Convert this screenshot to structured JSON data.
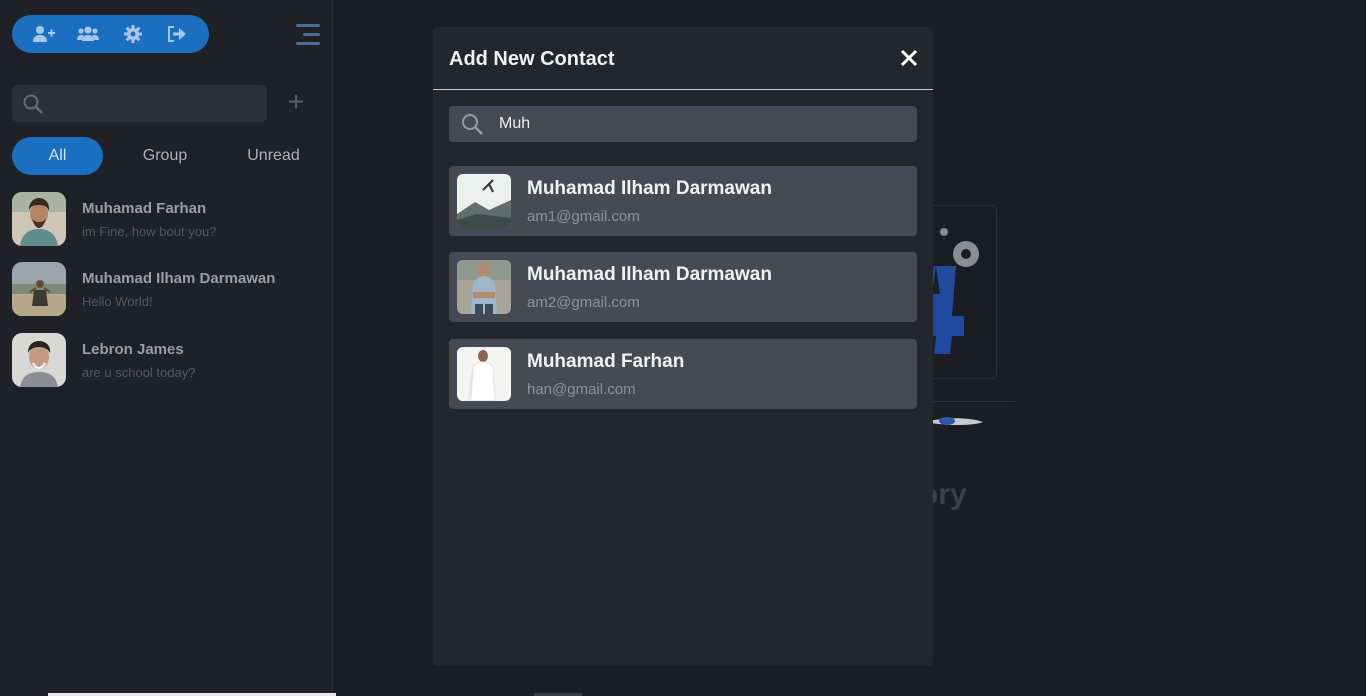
{
  "toolbar": {
    "icons": [
      "add-user-icon",
      "group-icon",
      "gear-icon",
      "logout-icon"
    ],
    "menu_icon": "hamburger-menu-icon"
  },
  "sidebar": {
    "search": {
      "value": "",
      "placeholder": ""
    },
    "add_icon": "+",
    "filters": [
      "All",
      "Group",
      "Unread"
    ],
    "active_filter": "All",
    "chats": [
      {
        "name": "Muhamad Farhan",
        "message": "im Fine, how bout you?"
      },
      {
        "name": "Muhamad Ilham Darmawan",
        "message": "Hello World!"
      },
      {
        "name": "Lebron James",
        "message": "are u school today?"
      }
    ]
  },
  "background": {
    "partial_word": "ory"
  },
  "modal": {
    "title": "Add New Contact",
    "close_icon": "close-icon",
    "search": {
      "value": "Muh"
    },
    "results": [
      {
        "name": "Muhamad Ilham Darmawan",
        "email": "am1@gmail.com"
      },
      {
        "name": "Muhamad Ilham Darmawan",
        "email": "am2@gmail.com"
      },
      {
        "name": "Muhamad Farhan",
        "email": "han@gmail.com"
      }
    ]
  },
  "colors": {
    "accent": "#1a6fc0",
    "modal_bg": "#24262d",
    "card_bg": "#474955",
    "page_bg": "#1b1d22"
  }
}
